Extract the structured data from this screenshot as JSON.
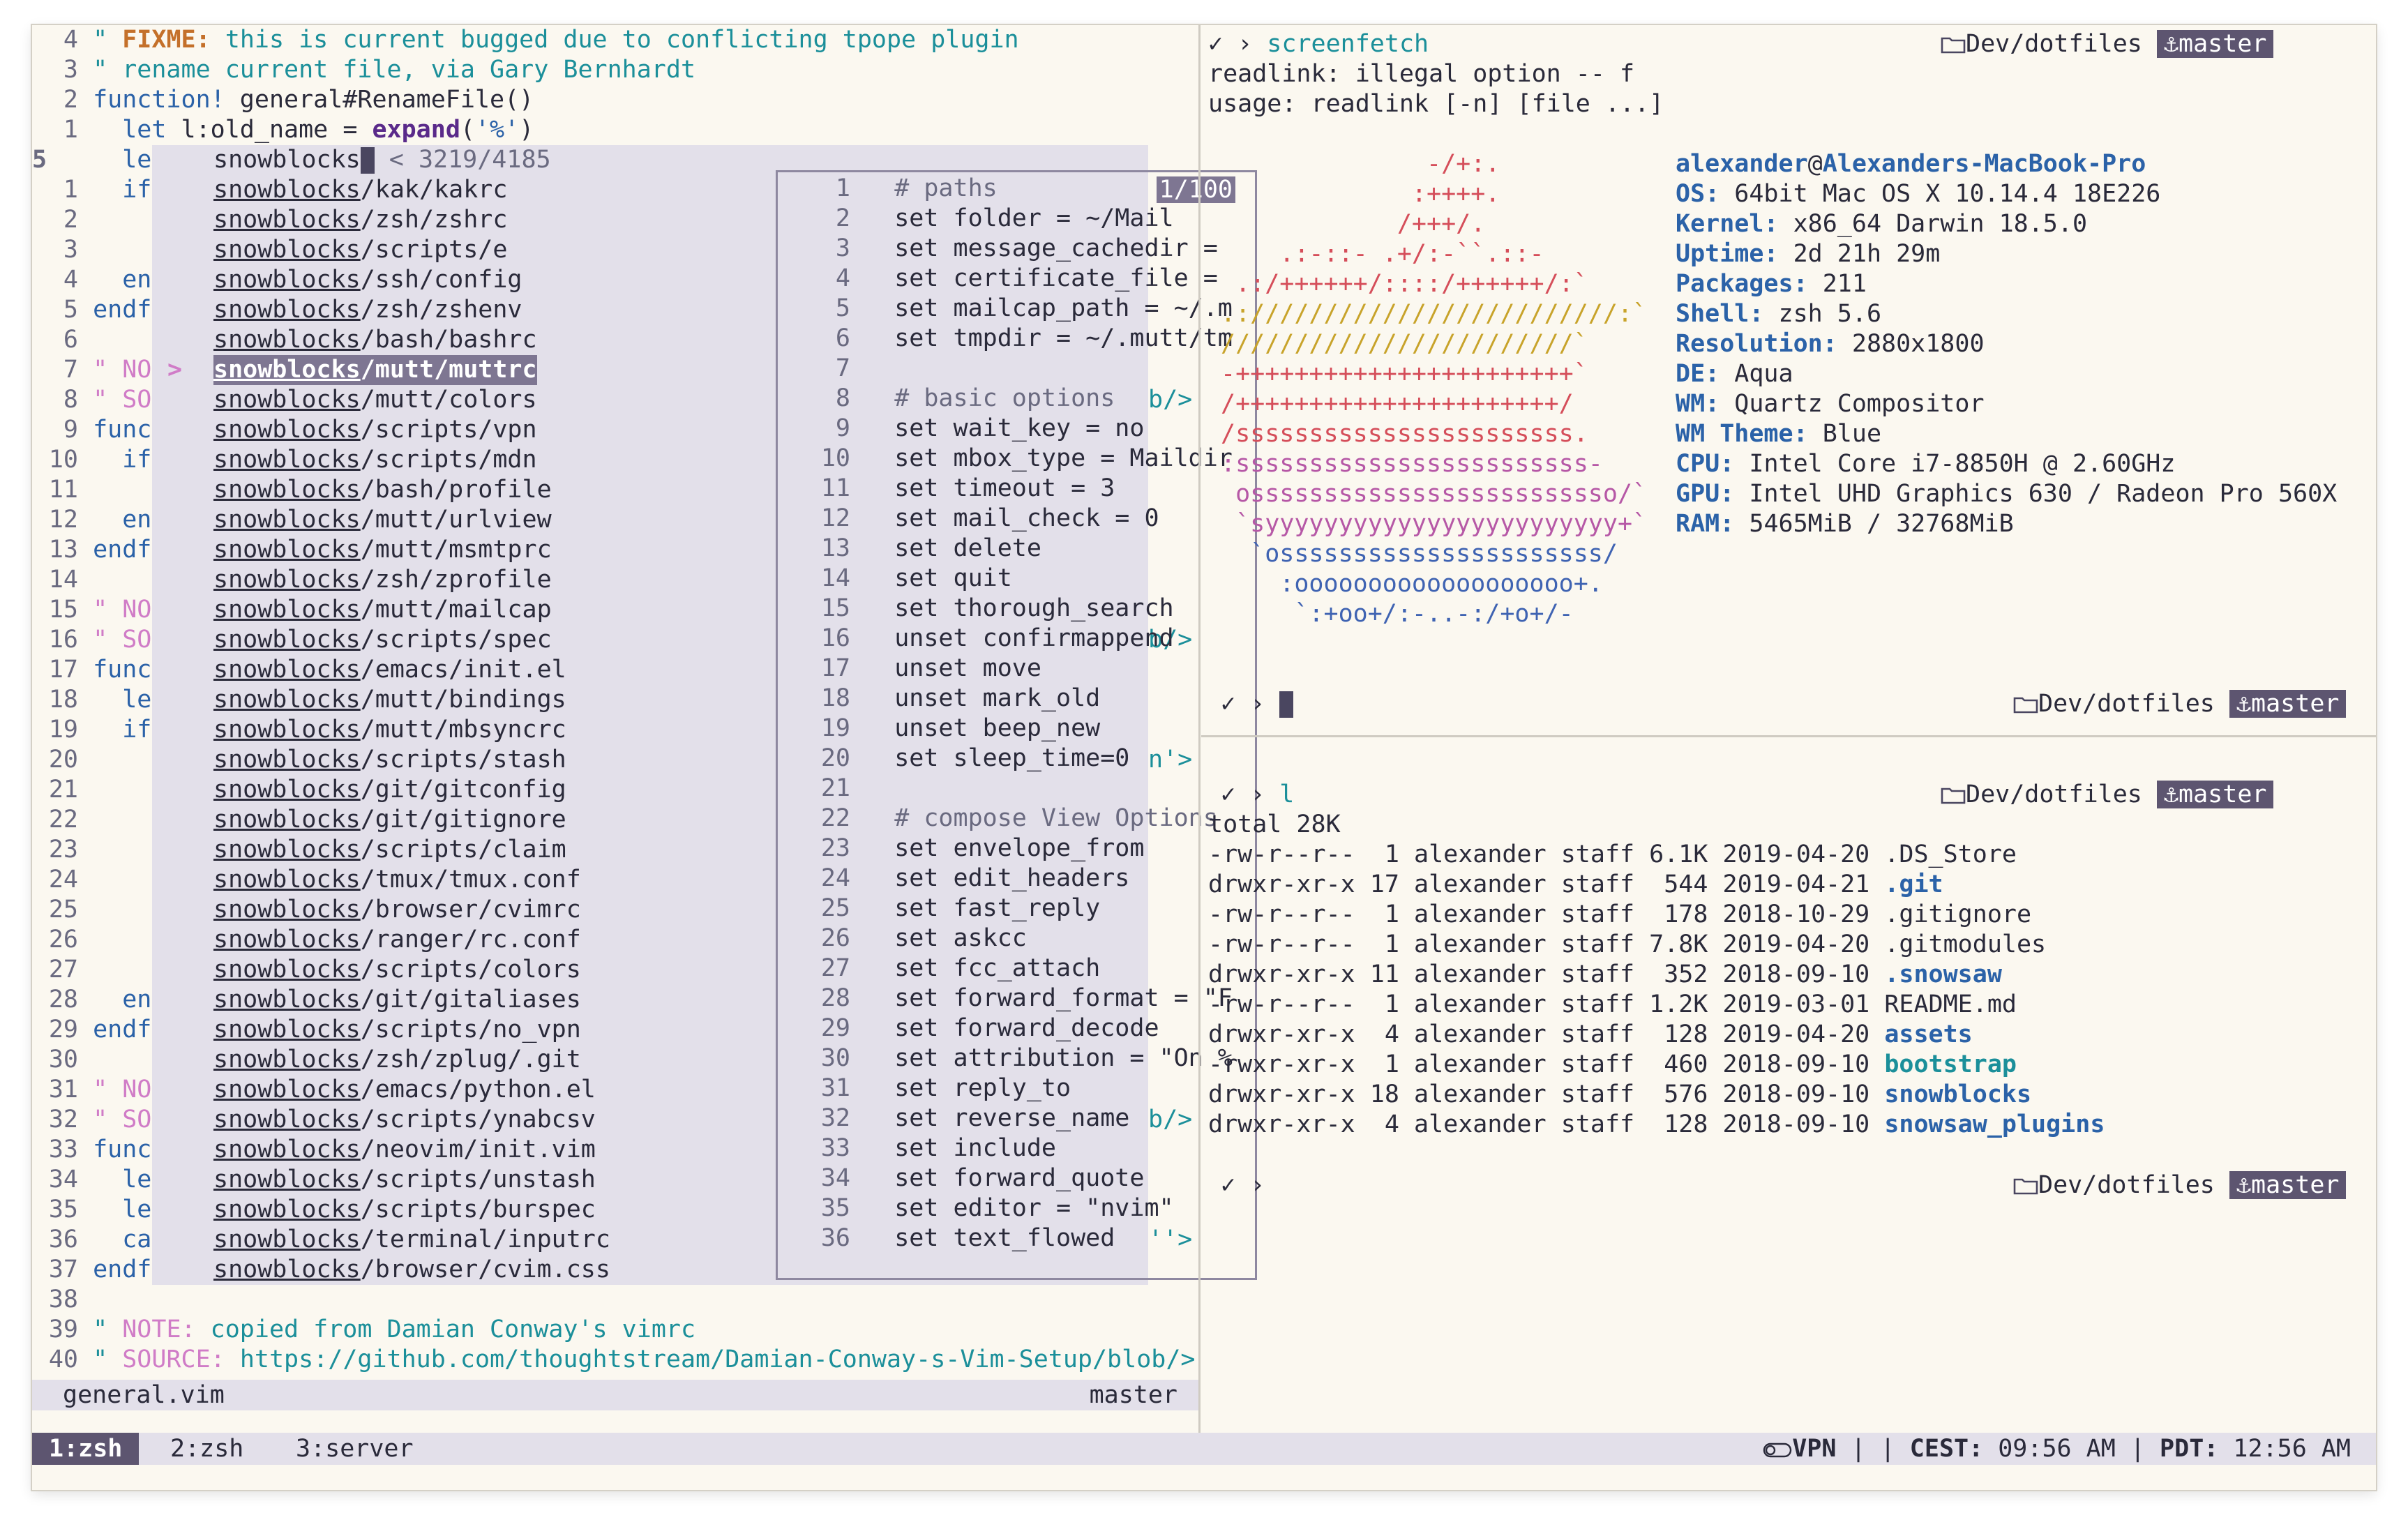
{
  "vim": {
    "lines_top": [
      {
        "n": "4",
        "text": "\" FIXME: this is current bugged due to conflicting tpope plugin"
      },
      {
        "n": "3",
        "text": "\" rename current file, via Gary Bernhardt"
      },
      {
        "n": "2",
        "text": "function! general#RenameFile()"
      },
      {
        "n": "1",
        "text": "  let l:old_name = expand('%')"
      }
    ],
    "cursor_line_num": "5",
    "cursor_prefix": "  le>",
    "rel_lines": [
      {
        "n": "1",
        "code": "  if"
      },
      {
        "n": "2",
        "code": ""
      },
      {
        "n": "3",
        "code": ""
      },
      {
        "n": "4",
        "code": "  en"
      },
      {
        "n": "5",
        "code": "endf"
      },
      {
        "n": "6",
        "code": ""
      },
      {
        "n": "7",
        "code": "\" NO>"
      },
      {
        "n": "8",
        "code": "\" SO"
      },
      {
        "n": "9",
        "code": "func"
      },
      {
        "n": "10",
        "code": "  if"
      },
      {
        "n": "11",
        "code": ""
      },
      {
        "n": "12",
        "code": "  en"
      },
      {
        "n": "13",
        "code": "endf"
      },
      {
        "n": "14",
        "code": ""
      },
      {
        "n": "15",
        "code": "\" NO"
      },
      {
        "n": "16",
        "code": "\" SO"
      },
      {
        "n": "17",
        "code": "func"
      },
      {
        "n": "18",
        "code": "  le"
      },
      {
        "n": "19",
        "code": "  if"
      },
      {
        "n": "20",
        "code": ""
      },
      {
        "n": "21",
        "code": ""
      },
      {
        "n": "22",
        "code": ""
      },
      {
        "n": "23",
        "code": ""
      },
      {
        "n": "24",
        "code": ""
      },
      {
        "n": "25",
        "code": ""
      },
      {
        "n": "26",
        "code": ""
      },
      {
        "n": "27",
        "code": ""
      },
      {
        "n": "28",
        "code": "  en"
      },
      {
        "n": "29",
        "code": "endf"
      },
      {
        "n": "30",
        "code": ""
      },
      {
        "n": "31",
        "code": "\" NO"
      },
      {
        "n": "32",
        "code": "\" SO"
      },
      {
        "n": "33",
        "code": "func"
      },
      {
        "n": "34",
        "code": "  le"
      },
      {
        "n": "35",
        "code": "  le"
      },
      {
        "n": "36",
        "code": "  ca"
      },
      {
        "n": "37",
        "code": "endf"
      }
    ],
    "right_edge": {
      "8": "b/>",
      "16": "b/>",
      "20": "n'>",
      "32": "b/>",
      "36": "''>"
    },
    "lines_bottom": [
      {
        "n": "38",
        "text": ""
      },
      {
        "n": "39",
        "text": "\" NOTE: copied from Damian Conway's vimrc"
      },
      {
        "n": "40",
        "text": "\" SOURCE: https://github.com/thoughtstream/Damian-Conway-s-Vim-Setup/blob/>"
      }
    ],
    "statusline": {
      "file": "general.vim",
      "branch": "master"
    }
  },
  "fzf": {
    "query": "snowblocks",
    "count": "< 3219/4185",
    "prompt": ">",
    "selected_index": 6,
    "items": [
      "snowblocks/kak/kakrc",
      "snowblocks/zsh/zshrc",
      "snowblocks/scripts/e",
      "snowblocks/ssh/config",
      "snowblocks/zsh/zshenv",
      "snowblocks/bash/bashrc",
      "snowblocks/mutt/muttrc",
      "snowblocks/mutt/colors",
      "snowblocks/scripts/vpn",
      "snowblocks/scripts/mdn",
      "snowblocks/bash/profile",
      "snowblocks/mutt/urlview",
      "snowblocks/mutt/msmtprc",
      "snowblocks/zsh/zprofile",
      "snowblocks/mutt/mailcap",
      "snowblocks/scripts/spec",
      "snowblocks/emacs/init.el",
      "snowblocks/mutt/bindings",
      "snowblocks/mutt/mbsyncrc",
      "snowblocks/scripts/stash",
      "snowblocks/git/gitconfig",
      "snowblocks/git/gitignore",
      "snowblocks/scripts/claim",
      "snowblocks/tmux/tmux.conf",
      "snowblocks/browser/cvimrc",
      "snowblocks/ranger/rc.conf",
      "snowblocks/scripts/colors",
      "snowblocks/git/gitaliases",
      "snowblocks/scripts/no_vpn",
      "snowblocks/zsh/zplug/.git",
      "snowblocks/emacs/python.el",
      "snowblocks/scripts/ynabcsv",
      "snowblocks/neovim/init.vim",
      "snowblocks/scripts/unstash",
      "snowblocks/scripts/burspec",
      "snowblocks/terminal/inputrc",
      "snowblocks/browser/cvim.css"
    ],
    "preview_badge": "1/100",
    "preview": [
      "# paths",
      "set folder = ~/Mail",
      "set message_cachedir =",
      "set certificate_file =",
      "set mailcap_path = ~/.m",
      "set tmpdir = ~/.mutt/tm",
      "",
      "# basic options",
      "set wait_key = no",
      "set mbox_type = Maildir",
      "set timeout = 3",
      "set mail_check = 0",
      "set delete",
      "set quit",
      "set thorough_search",
      "unset confirmappend",
      "unset move",
      "unset mark_old",
      "unset beep_new",
      "set sleep_time=0",
      "",
      "# compose View Options",
      "set envelope_from",
      "set edit_headers",
      "set fast_reply",
      "set askcc",
      "set fcc_attach",
      "set forward_format = \"F",
      "set forward_decode",
      "set attribution = \"On %",
      "set reply_to",
      "set reverse_name",
      "set include",
      "set forward_quote",
      "set editor = \"nvim\"",
      "set text_flowed"
    ]
  },
  "pane_top": {
    "prompt_check": "✓ ›",
    "command": "screenfetch",
    "dir": "Dev/dotfiles",
    "branch": "master",
    "output": [
      "readlink: illegal option -- f",
      "usage: readlink [-n] [file ...]"
    ],
    "logo": [
      "              -/+:.",
      "             :++++.",
      "            /+++/.",
      "    .:-::- .+/:-``.::-",
      " .:/++++++/::::/++++++/:`",
      ".://///////////////////////:`",
      "////////////////////////`",
      "-+++++++++++++++++++++++`",
      "/++++++++++++++++++++++/",
      "/sssssssssssssssssssssss.",
      ":ssssssssssssssssssssssss-",
      " osssssssssssssssssssssssso/`",
      " `syyyyyyyyyyyyyyyyyyyyyyyy+`",
      "  `ossssssssssssssssssssss/",
      "    :ooooooooooooooooooo+.",
      "     `:+oo+/:-..-:/+o+/-"
    ],
    "user": "alexander",
    "at": "@",
    "host": "Alexanders-MacBook-Pro",
    "info": [
      {
        "k": "OS:",
        "v": "64bit Mac OS X 10.14.4 18E226"
      },
      {
        "k": "Kernel:",
        "v": "x86_64 Darwin 18.5.0"
      },
      {
        "k": "Uptime:",
        "v": "2d 21h 29m"
      },
      {
        "k": "Packages:",
        "v": "211"
      },
      {
        "k": "Shell:",
        "v": "zsh 5.6"
      },
      {
        "k": "Resolution:",
        "v": "2880x1800"
      },
      {
        "k": "DE:",
        "v": "Aqua"
      },
      {
        "k": "WM:",
        "v": "Quartz Compositor"
      },
      {
        "k": "WM Theme:",
        "v": "Blue"
      },
      {
        "k": "CPU:",
        "v": "Intel Core i7-8850H @ 2.60GHz"
      },
      {
        "k": "GPU:",
        "v": "Intel UHD Graphics 630 / Radeon Pro 560X"
      },
      {
        "k": "RAM:",
        "v": "5465MiB / 32768MiB"
      }
    ],
    "prompt2_check": "✓ ›"
  },
  "pane_bottom": {
    "prompt_check": "✓ ›",
    "command": "l",
    "dir": "Dev/dotfiles",
    "branch": "master",
    "total": "total 28K",
    "listing": [
      {
        "meta": "-rw-r--r--  1 alexander staff 6.1K 2019-04-20 ",
        "name": ".DS_Store",
        "style": "plain"
      },
      {
        "meta": "drwxr-xr-x 17 alexander staff  544 2019-04-21 ",
        "name": ".git",
        "style": "dir"
      },
      {
        "meta": "-rw-r--r--  1 alexander staff  178 2018-10-29 ",
        "name": ".gitignore",
        "style": "plain"
      },
      {
        "meta": "-rw-r--r--  1 alexander staff 7.8K 2019-04-20 ",
        "name": ".gitmodules",
        "style": "plain"
      },
      {
        "meta": "drwxr-xr-x 11 alexander staff  352 2018-09-10 ",
        "name": ".snowsaw",
        "style": "dir"
      },
      {
        "meta": "-rw-r--r--  1 alexander staff 1.2K 2019-03-01 ",
        "name": "README.md",
        "style": "plain"
      },
      {
        "meta": "drwxr-xr-x  4 alexander staff  128 2019-04-20 ",
        "name": "assets",
        "style": "dir"
      },
      {
        "meta": "-rwxr-xr-x  1 alexander staff  460 2018-09-10 ",
        "name": "bootstrap",
        "style": "exec"
      },
      {
        "meta": "drwxr-xr-x 18 alexander staff  576 2018-09-10 ",
        "name": "snowblocks",
        "style": "dir"
      },
      {
        "meta": "drwxr-xr-x  4 alexander staff  128 2018-09-10 ",
        "name": "snowsaw_plugins",
        "style": "dir"
      }
    ],
    "prompt2_check": "✓ ›"
  },
  "tmux": {
    "windows": [
      "1:zsh",
      "2:zsh",
      "3:server"
    ],
    "active": 0,
    "vpn": "VPN",
    "sep": "|",
    "tz1_label": "CEST:",
    "tz1": "09:56 AM",
    "tz2_label": "PDT:",
    "tz2": "12:56 AM"
  },
  "icons": {
    "folder": "folder-icon",
    "anchor": "anchor-icon",
    "vpn": "vpn-toggle-icon"
  },
  "colors": {
    "accent": "#7e7692",
    "bg": "#fbf8f0",
    "comment": "#1b8f9a",
    "keyword": "#2b62a8"
  }
}
